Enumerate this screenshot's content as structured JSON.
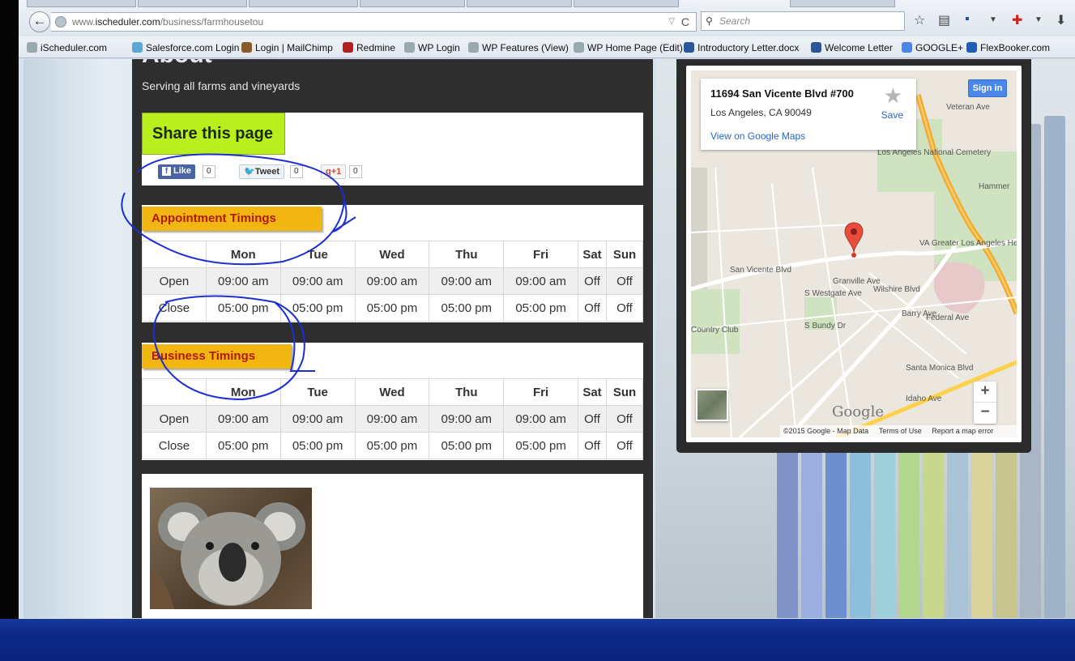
{
  "browser": {
    "url_prefix": "www.",
    "url_domain": "ischeduler.com",
    "url_path": "/business/farmhousetou",
    "search_placeholder": "Search",
    "back_glyph": "←",
    "reload_glyph": "C",
    "dropdown_glyph": "▽"
  },
  "bookmarks": [
    {
      "label": "iScheduler.com",
      "icon": "globe-icon",
      "color": "#9aa"
    },
    {
      "label": "Salesforce.com Login ...",
      "icon": "cloud-icon",
      "color": "#5aa7d8"
    },
    {
      "label": "Login | MailChimp",
      "icon": "chimp-icon",
      "color": "#8b5a2b"
    },
    {
      "label": "Redmine",
      "icon": "redmine-icon",
      "color": "#b42020"
    },
    {
      "label": "WP Login",
      "icon": "globe-icon",
      "color": "#9aa"
    },
    {
      "label": "WP Features (View)",
      "icon": "globe-icon",
      "color": "#9aa"
    },
    {
      "label": "WP Home Page (Edit)",
      "icon": "globe-icon",
      "color": "#9aa"
    },
    {
      "label": "Introductory Letter.docx",
      "icon": "word-icon",
      "color": "#2b579a"
    },
    {
      "label": "Welcome Letter",
      "icon": "word-icon",
      "color": "#2b579a"
    },
    {
      "label": "GOOGLE+",
      "icon": "google-icon",
      "color": "#4a86e8"
    },
    {
      "label": "FlexBooker.com",
      "icon": "fb-icon",
      "color": "#1e5fb8"
    }
  ],
  "page": {
    "heading": "About",
    "tagline": "Serving all farms and vineyards"
  },
  "share": {
    "title": "Share this page",
    "like_label": "Like",
    "like_count": "0",
    "tweet_label": "Tweet",
    "tweet_count": "0",
    "gplus_label": "+1",
    "gplus_count": "0"
  },
  "appointment": {
    "title": "Appointment Timings",
    "days": [
      "Mon",
      "Tue",
      "Wed",
      "Thu",
      "Fri",
      "Sat",
      "Sun"
    ],
    "open_label": "Open",
    "close_label": "Close",
    "open": [
      "09:00 am",
      "09:00 am",
      "09:00 am",
      "09:00 am",
      "09:00 am",
      "Off",
      "Off"
    ],
    "close": [
      "05:00 pm",
      "05:00 pm",
      "05:00 pm",
      "05:00 pm",
      "05:00 pm",
      "Off",
      "Off"
    ]
  },
  "business": {
    "title": "Business Timings",
    "days": [
      "Mon",
      "Tue",
      "Wed",
      "Thu",
      "Fri",
      "Sat",
      "Sun"
    ],
    "open_label": "Open",
    "close_label": "Close",
    "open": [
      "09:00 am",
      "09:00 am",
      "09:00 am",
      "09:00 am",
      "09:00 am",
      "Off",
      "Off"
    ],
    "close": [
      "05:00 pm",
      "05:00 pm",
      "05:00 pm",
      "05:00 pm",
      "05:00 pm",
      "Off",
      "Off"
    ]
  },
  "map": {
    "address_line1": "11694 San Vicente Blvd #700",
    "address_line2": "Los Angeles, CA 90049",
    "view_link": "View on Google Maps",
    "save_label": "Save",
    "signin_label": "Sign in",
    "zoom_in": "+",
    "zoom_out": "−",
    "logo": "Google",
    "copyright": "©2015 Google - Map Data",
    "terms": "Terms of Use",
    "report": "Report a map error",
    "labels": [
      "Los Angeles National Cemetery",
      "Hammer",
      "VA Greater Los Angeles Healthcare Center",
      "San Vicente Blvd",
      "Wilshire Blvd",
      "Santa Monica Blvd",
      "Country Club",
      "Granville Ave",
      "S Westgate Ave",
      "Barry Ave",
      "Federal Ave",
      "S Bundy Dr",
      "Veteran Ave",
      "Idaho Ave"
    ]
  }
}
